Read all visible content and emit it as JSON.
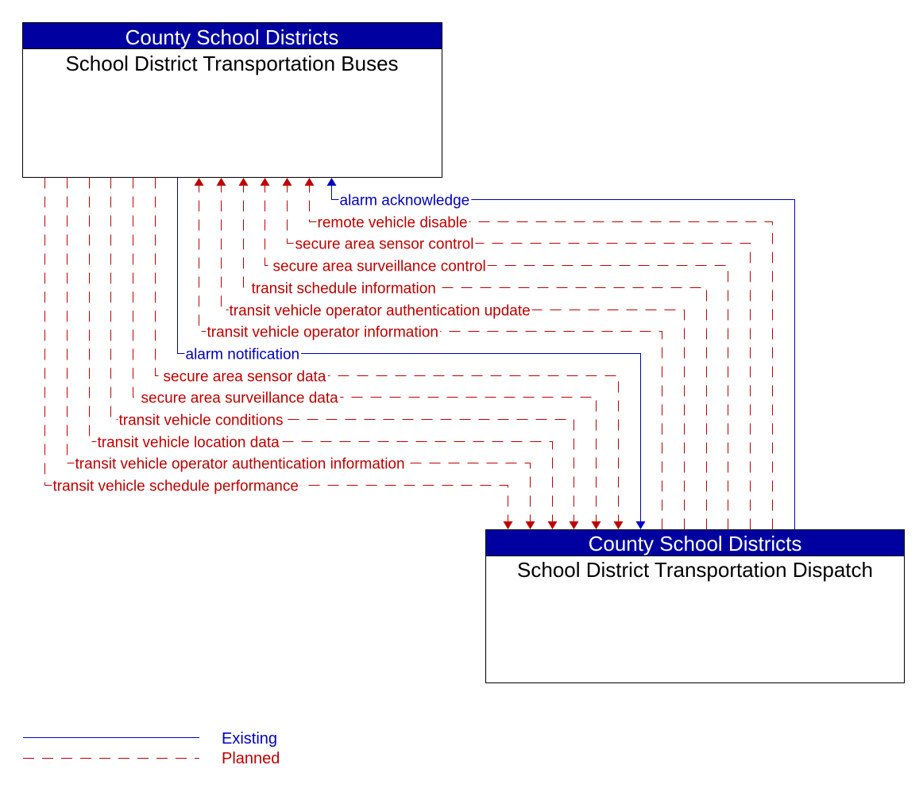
{
  "colors": {
    "existing": "#0000c0",
    "planned": "#c00000",
    "header_bg": "#0000a0",
    "header_text": "#ffffff",
    "box_border": "#000000"
  },
  "nodes": {
    "buses": {
      "owner": "County School Districts",
      "title": "School District Transportation Buses"
    },
    "dispatch": {
      "owner": "County School Districts",
      "title": "School District Transportation Dispatch"
    }
  },
  "flows": [
    {
      "label": "alarm acknowledge",
      "status": "existing",
      "direction": "to-buses"
    },
    {
      "label": "remote vehicle disable",
      "status": "planned",
      "direction": "to-buses"
    },
    {
      "label": "secure area sensor control",
      "status": "planned",
      "direction": "to-buses"
    },
    {
      "label": "secure area surveillance control",
      "status": "planned",
      "direction": "to-buses"
    },
    {
      "label": "transit schedule information",
      "status": "planned",
      "direction": "to-buses"
    },
    {
      "label": "transit vehicle operator authentication update",
      "status": "planned",
      "direction": "to-buses"
    },
    {
      "label": "transit vehicle operator information",
      "status": "planned",
      "direction": "to-buses"
    },
    {
      "label": "alarm notification",
      "status": "existing",
      "direction": "to-dispatch"
    },
    {
      "label": "secure area sensor data",
      "status": "planned",
      "direction": "to-dispatch"
    },
    {
      "label": "secure area surveillance data",
      "status": "planned",
      "direction": "to-dispatch"
    },
    {
      "label": "transit vehicle conditions",
      "status": "planned",
      "direction": "to-dispatch"
    },
    {
      "label": "transit vehicle location data",
      "status": "planned",
      "direction": "to-dispatch"
    },
    {
      "label": "transit vehicle operator authentication information",
      "status": "planned",
      "direction": "to-dispatch"
    },
    {
      "label": "transit vehicle schedule performance",
      "status": "planned",
      "direction": "to-dispatch"
    }
  ],
  "legend": {
    "existing": "Existing",
    "planned": "Planned"
  }
}
